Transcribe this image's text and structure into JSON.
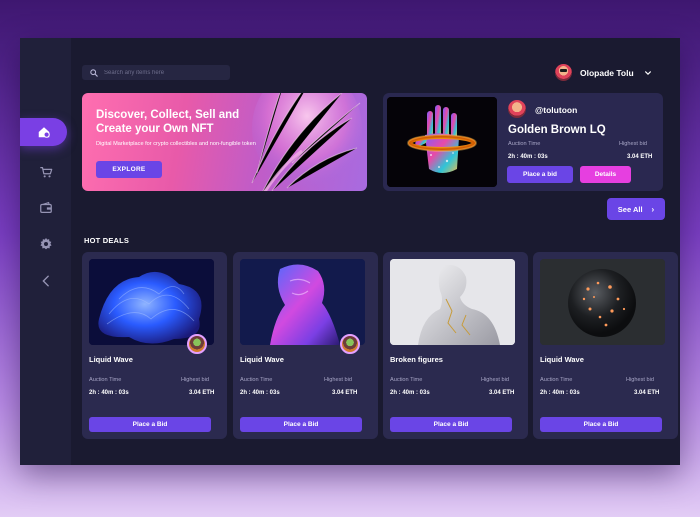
{
  "search": {
    "placeholder": "Search any items here"
  },
  "user": {
    "name": "Olopade Tolu"
  },
  "hero": {
    "title": "Discover, Collect, Sell and Create your Own NFT",
    "subtitle": "Digital Marketplace for crypto collectibles and non-fungible token",
    "button_label": "EXPLORE"
  },
  "featured": {
    "handle": "@tolutoon",
    "title": "Golden Brown LQ",
    "auction_label": "Auction Time",
    "bid_label": "Highest bid",
    "auction_value": "2h : 40m : 03s",
    "bid_value": "3.04 ETH",
    "place_bid_label": "Place a bid",
    "details_label": "Details"
  },
  "see_all_label": "See All",
  "hot_deals": {
    "title": "HOT DEALS",
    "cards": [
      {
        "name": "Liquid Wave",
        "auction_label": "Auction Time",
        "bid_label": "Highest bid",
        "auction_value": "2h : 40m : 03s",
        "bid_value": "3.04 ETH",
        "button_label": "Place a  Bid"
      },
      {
        "name": "Liquid Wave",
        "auction_label": "Auction Time",
        "bid_label": "Highest bid",
        "auction_value": "2h : 40m : 03s",
        "bid_value": "3.04 ETH",
        "button_label": "Place a  Bid"
      },
      {
        "name": "Broken figures",
        "auction_label": "Auction Time",
        "bid_label": "Highest bid",
        "auction_value": "2h : 40m : 03s",
        "bid_value": "3.04 ETH",
        "button_label": "Place a  Bid"
      },
      {
        "name": "Liquid Wave",
        "auction_label": "Auction Time",
        "bid_label": "Highest bid",
        "auction_value": "2h : 40m : 03s",
        "bid_value": "3.04 ETH",
        "button_label": "Place a  Bid"
      }
    ]
  },
  "nav": {
    "items": [
      {
        "icon": "home-icon"
      },
      {
        "icon": "cart-icon"
      },
      {
        "icon": "wallet-icon"
      },
      {
        "icon": "gear-icon"
      },
      {
        "icon": "chevron-left-icon"
      }
    ]
  },
  "colors": {
    "accent": "#6a45e6",
    "details_button": "#e63fe0",
    "sidebar_active": "#7a3fe4",
    "card_bg": "#2b2a4f",
    "app_bg": "#1a1a30"
  }
}
